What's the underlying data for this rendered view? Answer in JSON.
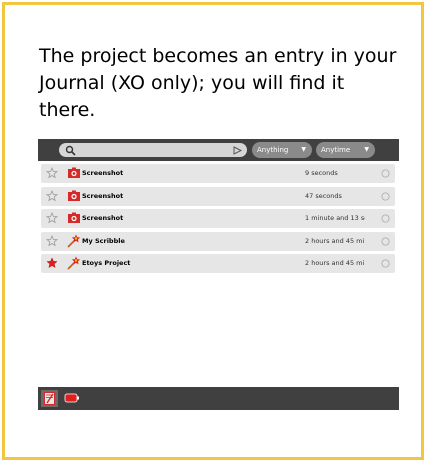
{
  "caption": "The project becomes an entry in your Journal (XO only); you will find it there.",
  "toolbar": {
    "search_value": "",
    "filter_what": "Anything",
    "filter_when": "Anytime"
  },
  "entries": [
    {
      "title": "Screenshot",
      "date": "9 seconds",
      "starred": false,
      "icon": "screenshot-icon"
    },
    {
      "title": "Screenshot",
      "date": "47 seconds",
      "starred": false,
      "icon": "screenshot-icon"
    },
    {
      "title": "Screenshot",
      "date": "1 minute and 13 se",
      "starred": false,
      "icon": "screenshot-icon"
    },
    {
      "title": "My Scribble",
      "date": "2 hours and 45 mi",
      "starred": false,
      "icon": "etoys-icon"
    },
    {
      "title": "Etoys Project",
      "date": "2 hours and 45 mi",
      "starred": true,
      "icon": "etoys-icon"
    }
  ],
  "colors": {
    "frame_border": "#f2c641",
    "toolbar_bg": "#404040",
    "row_bg": "#e6e6e6",
    "star_active": "#e01e1e",
    "activity_red": "#d42a2a"
  }
}
